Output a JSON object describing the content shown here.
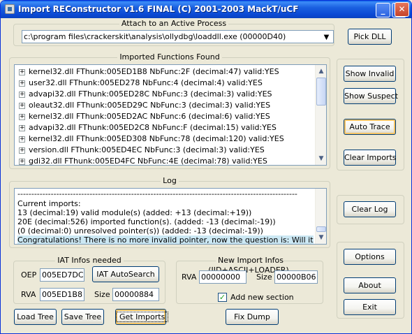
{
  "window": {
    "title": "Import REConstructor v1.6 FINAL (C) 2001-2003 MackT/uCF",
    "minimize_glyph": "_",
    "maximize_glyph": "□",
    "close_glyph": "✕"
  },
  "attach": {
    "group_label": "Attach to an Active Process",
    "process_value": "c:\\program files\\crackerskit\\analysis\\ollydbg\\loaddll.exe (00000D40)",
    "pick_dll_label": "Pick DLL"
  },
  "imports": {
    "group_label": "Imported Functions Found",
    "rows": [
      "kernel32.dll FThunk:005ED1B8 NbFunc:2F (decimal:47) valid:YES",
      "user32.dll FThunk:005ED278 NbFunc:4 (decimal:4) valid:YES",
      "advapi32.dll FThunk:005ED28C NbFunc:3 (decimal:3) valid:YES",
      "oleaut32.dll FThunk:005ED29C NbFunc:3 (decimal:3) valid:YES",
      "kernel32.dll FThunk:005ED2AC NbFunc:6 (decimal:6) valid:YES",
      "advapi32.dll FThunk:005ED2C8 NbFunc:F (decimal:15) valid:YES",
      "kernel32.dll FThunk:005ED308 NbFunc:78 (decimal:120) valid:YES",
      "version.dll FThunk:005ED4EC NbFunc:3 (decimal:3) valid:YES",
      "gdi32.dll FThunk:005ED4FC NbFunc:4E (decimal:78) valid:YES"
    ]
  },
  "side_buttons": {
    "show_invalid": "Show Invalid",
    "show_suspect": "Show Suspect",
    "auto_trace": "Auto Trace",
    "clear_imports": "Clear Imports",
    "clear_log": "Clear Log",
    "options": "Options",
    "about": "About",
    "exit": "Exit"
  },
  "log": {
    "group_label": "Log",
    "separator": "-----------------------------------------------------------------------------------------------------",
    "lines": [
      "Current imports:",
      "13 (decimal:19) valid module(s) (added: +13 (decimal:+19))",
      "20E (decimal:526) imported function(s). (added: -13 (decimal:-19))",
      "(0 (decimal:0) unresolved pointer(s)) (added: -13 (decimal:-19))",
      "Congratulations! There is no more invalid pointer, now the question is: Will it work? :-)"
    ]
  },
  "iat": {
    "group_label": "IAT Infos needed",
    "oep_label": "OEP",
    "oep_value": "005ED7DC",
    "autosearch_label": "IAT AutoSearch",
    "rva_label": "RVA",
    "rva_value": "005ED1B8",
    "size_label": "Size",
    "size_value": "00000884"
  },
  "new_import": {
    "group_label": "New Import Infos (IID+ASCII+LOADER)",
    "rva_label": "RVA",
    "rva_value": "00000000",
    "size_label": "Size",
    "size_value": "00000B06",
    "add_section_label": "Add new section",
    "check_glyph": "✓"
  },
  "bottom_buttons": {
    "load_tree": "Load Tree",
    "save_tree": "Save Tree",
    "get_imports": "Get Imports",
    "fix_dump": "Fix Dump"
  },
  "icons": {
    "expand": "+",
    "scroll_up": "▲",
    "scroll_down": "▼",
    "combo_down": "▼"
  }
}
